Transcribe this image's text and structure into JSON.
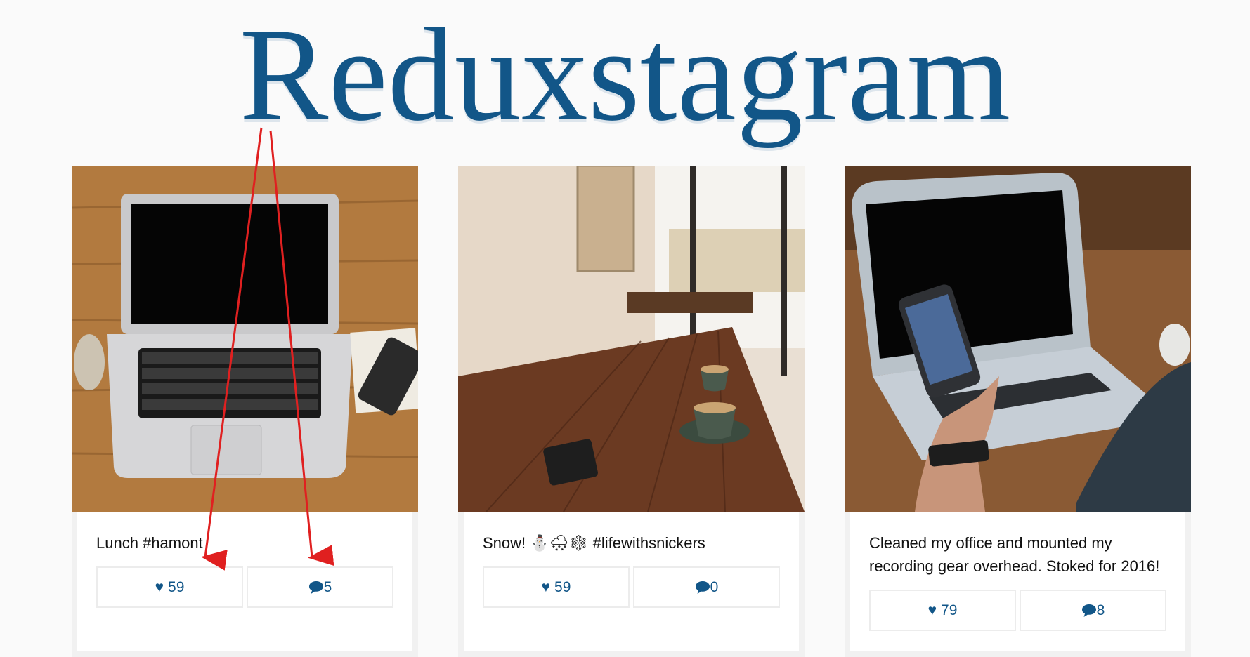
{
  "app": {
    "title": "Reduxstagram"
  },
  "posts": [
    {
      "caption": "Lunch #hamont",
      "likes": "59",
      "comments": "5",
      "photo": "laptop-on-wooden-desk"
    },
    {
      "caption": "Snow! ⛄🌨❄ #lifewithsnickers",
      "likes": "59",
      "comments": "0",
      "photo": "cafe-table-with-coffee"
    },
    {
      "caption": "Cleaned my office and mounted my recording gear overhead. Stoked for 2016!",
      "likes": "79",
      "comments": "8",
      "photo": "hand-holding-phone-by-laptop"
    }
  ],
  "icons": {
    "like": "heart-icon",
    "comment": "speech-bubble-icon"
  },
  "colors": {
    "accent": "#125688",
    "annotation": "#e02020"
  },
  "annotation": {
    "arrow_count": 2,
    "targets": [
      "like-button",
      "comment-button"
    ]
  }
}
